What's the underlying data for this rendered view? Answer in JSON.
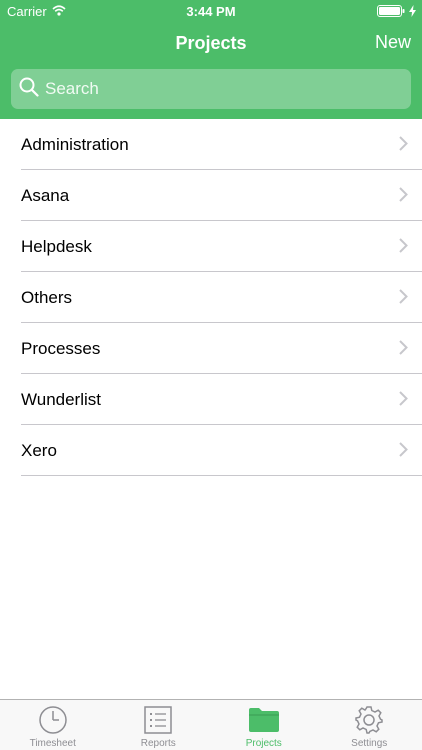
{
  "status_bar": {
    "carrier": "Carrier",
    "time": "3:44 PM"
  },
  "nav": {
    "title": "Projects",
    "new_label": "New"
  },
  "search": {
    "placeholder": "Search",
    "value": ""
  },
  "projects": [
    {
      "label": "Administration"
    },
    {
      "label": "Asana"
    },
    {
      "label": "Helpdesk"
    },
    {
      "label": "Others"
    },
    {
      "label": "Processes"
    },
    {
      "label": "Wunderlist"
    },
    {
      "label": "Xero"
    }
  ],
  "tabs": [
    {
      "label": "Timesheet",
      "icon": "clock-icon",
      "active": false
    },
    {
      "label": "Reports",
      "icon": "list-icon",
      "active": false
    },
    {
      "label": "Projects",
      "icon": "folder-icon",
      "active": true
    },
    {
      "label": "Settings",
      "icon": "gear-icon",
      "active": false
    }
  ],
  "colors": {
    "accent": "#4cbd69",
    "search_bg": "#80cf95",
    "inactive": "#8e8e93",
    "separator": "#c8c7cc"
  }
}
